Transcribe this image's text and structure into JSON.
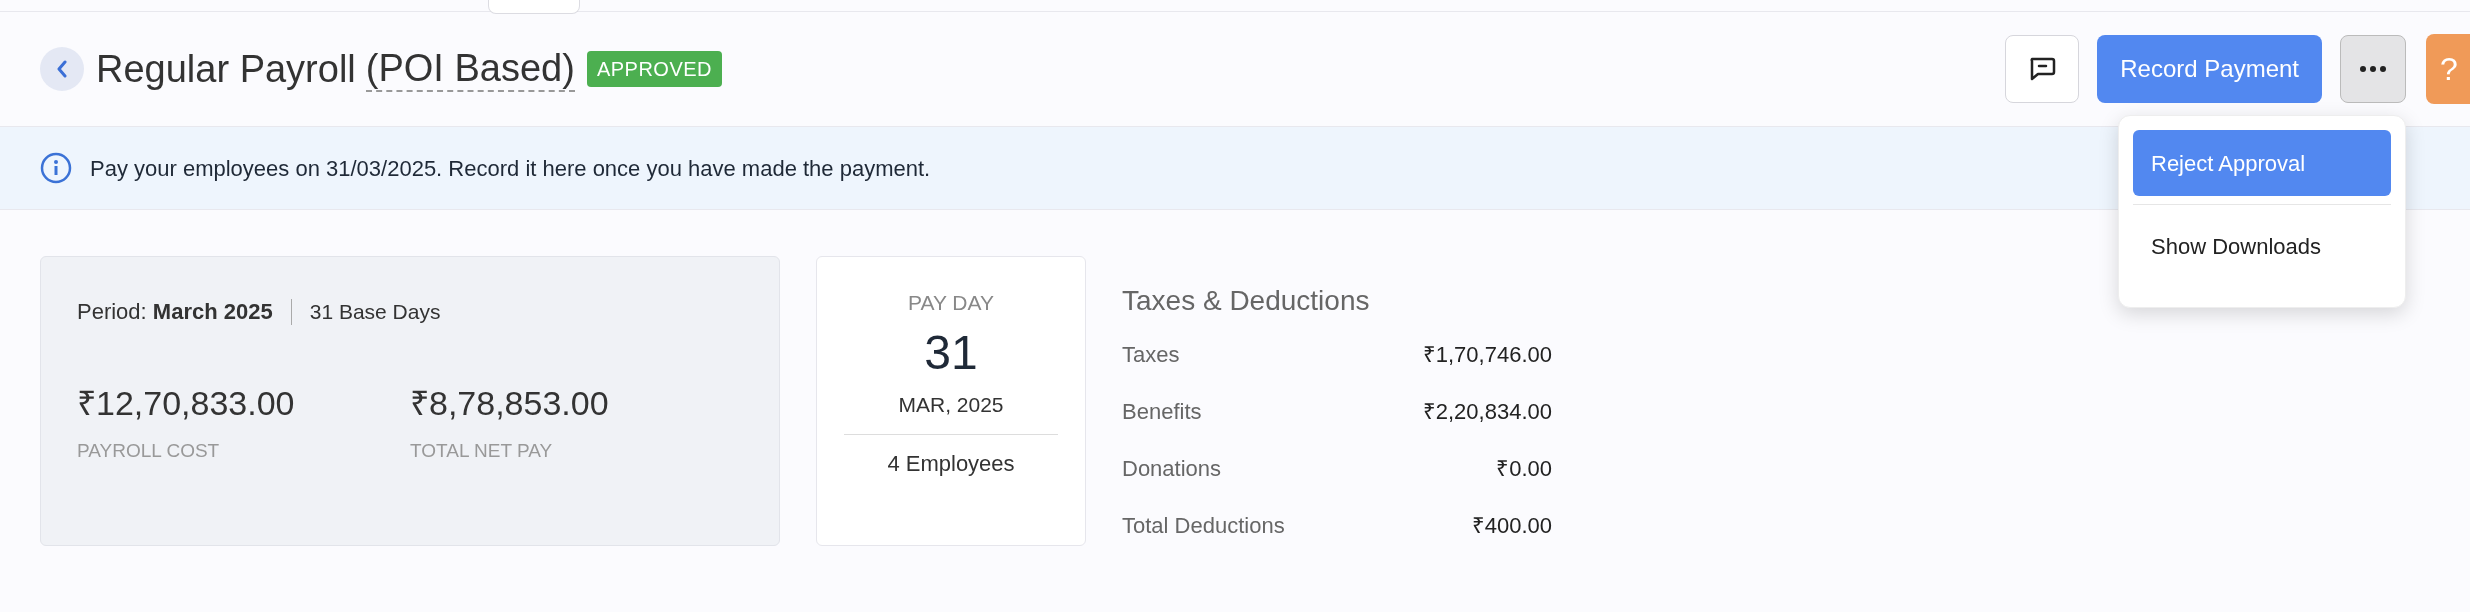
{
  "header": {
    "title": "Regular Payroll",
    "subtitle": "(POI Based)",
    "status": "APPROVED",
    "actions": {
      "primary": "Record Payment",
      "help": "?"
    }
  },
  "menu": {
    "items": [
      {
        "label": "Reject Approval",
        "selected": true
      },
      {
        "label": "Show Downloads",
        "selected": false
      }
    ]
  },
  "banner": {
    "text": "Pay your employees on 31/03/2025. Record it here once you have made the payment."
  },
  "summary": {
    "period_label": "Period:",
    "period": "March 2025",
    "base_days": "31 Base Days",
    "figures": [
      {
        "amount": "₹12,70,833.00",
        "label": "PAYROLL COST"
      },
      {
        "amount": "₹8,78,853.00",
        "label": "TOTAL NET PAY"
      }
    ]
  },
  "pay_day": {
    "label": "PAY DAY",
    "day": "31",
    "month_year": "MAR, 2025",
    "employees": "4 Employees"
  },
  "deductions": {
    "title": "Taxes & Deductions",
    "rows": [
      {
        "label": "Taxes",
        "amount": "₹1,70,746.00"
      },
      {
        "label": "Benefits",
        "amount": "₹2,20,834.00"
      },
      {
        "label": "Donations",
        "amount": "₹0.00"
      },
      {
        "label": "Total Deductions",
        "amount": "₹400.00"
      }
    ]
  }
}
